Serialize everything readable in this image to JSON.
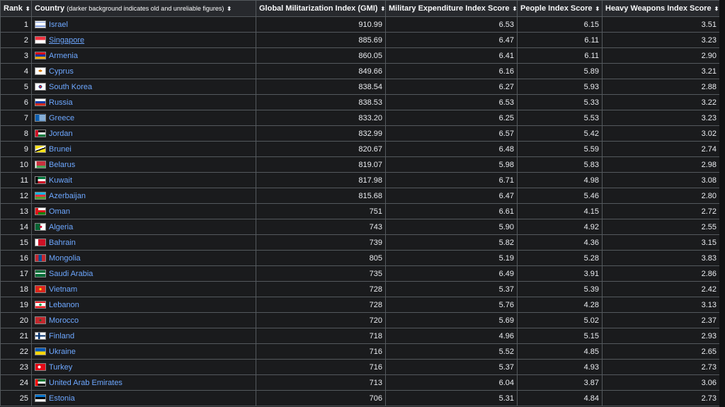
{
  "headers": {
    "rank": "Rank",
    "country": "Country",
    "country_note": "(darker background indicates old and unreliable figures)",
    "gmi": "Global Militarization Index (GMI)",
    "mil": "Military Expenditure Index Score",
    "people": "People Index Score",
    "heavy": "Heavy Weapons Index Score",
    "sort_icon": "⬍"
  },
  "rows": [
    {
      "rank": "1",
      "country": "Israel",
      "gmi": "910.99",
      "mil": "6.53",
      "people": "6.15",
      "heavy": "3.51",
      "flag": "israel-flag"
    },
    {
      "rank": "2",
      "country": "Singapore",
      "gmi": "885.69",
      "mil": "6.47",
      "people": "6.11",
      "heavy": "3.23",
      "flag": "singapore-flag"
    },
    {
      "rank": "3",
      "country": "Armenia",
      "gmi": "860.05",
      "mil": "6.41",
      "people": "6.11",
      "heavy": "2.90",
      "flag": "armenia-flag"
    },
    {
      "rank": "4",
      "country": "Cyprus",
      "gmi": "849.66",
      "mil": "6.16",
      "people": "5.89",
      "heavy": "3.21",
      "flag": "cyprus-flag"
    },
    {
      "rank": "5",
      "country": "South Korea",
      "gmi": "838.54",
      "mil": "6.27",
      "people": "5.93",
      "heavy": "2.88",
      "flag": "south-korea-flag"
    },
    {
      "rank": "6",
      "country": "Russia",
      "gmi": "838.53",
      "mil": "6.53",
      "people": "5.33",
      "heavy": "3.22",
      "flag": "russia-flag"
    },
    {
      "rank": "7",
      "country": "Greece",
      "gmi": "833.20",
      "mil": "6.25",
      "people": "5.53",
      "heavy": "3.23",
      "flag": "greece-flag"
    },
    {
      "rank": "8",
      "country": "Jordan",
      "gmi": "832.99",
      "mil": "6.57",
      "people": "5.42",
      "heavy": "3.02",
      "flag": "jordan-flag"
    },
    {
      "rank": "9",
      "country": "Brunei",
      "gmi": "820.67",
      "mil": "6.48",
      "people": "5.59",
      "heavy": "2.74",
      "flag": "brunei-flag"
    },
    {
      "rank": "10",
      "country": "Belarus",
      "gmi": "819.07",
      "mil": "5.98",
      "people": "5.83",
      "heavy": "2.98",
      "flag": "belarus-flag"
    },
    {
      "rank": "11",
      "country": "Kuwait",
      "gmi": "817.98",
      "mil": "6.71",
      "people": "4.98",
      "heavy": "3.08",
      "flag": "kuwait-flag"
    },
    {
      "rank": "12",
      "country": "Azerbaijan",
      "gmi": "815.68",
      "mil": "6.47",
      "people": "5.46",
      "heavy": "2.80",
      "flag": "azerbaijan-flag"
    },
    {
      "rank": "13",
      "country": "Oman",
      "gmi": "751",
      "mil": "6.61",
      "people": "4.15",
      "heavy": "2.72",
      "flag": "oman-flag"
    },
    {
      "rank": "14",
      "country": "Algeria",
      "gmi": "743",
      "mil": "5.90",
      "people": "4.92",
      "heavy": "2.55",
      "flag": "algeria-flag"
    },
    {
      "rank": "15",
      "country": "Bahrain",
      "gmi": "739",
      "mil": "5.82",
      "people": "4.36",
      "heavy": "3.15",
      "flag": "bahrain-flag"
    },
    {
      "rank": "16",
      "country": "Mongolia",
      "gmi": "805",
      "mil": "5.19",
      "people": "5.28",
      "heavy": "3.83",
      "flag": "mongolia-flag"
    },
    {
      "rank": "17",
      "country": "Saudi Arabia",
      "gmi": "735",
      "mil": "6.49",
      "people": "3.91",
      "heavy": "2.86",
      "flag": "saudi-arabia-flag"
    },
    {
      "rank": "18",
      "country": "Vietnam",
      "gmi": "728",
      "mil": "5.37",
      "people": "5.39",
      "heavy": "2.42",
      "flag": "vietnam-flag"
    },
    {
      "rank": "19",
      "country": "Lebanon",
      "gmi": "728",
      "mil": "5.76",
      "people": "4.28",
      "heavy": "3.13",
      "flag": "lebanon-flag"
    },
    {
      "rank": "20",
      "country": "Morocco",
      "gmi": "720",
      "mil": "5.69",
      "people": "5.02",
      "heavy": "2.37",
      "flag": "morocco-flag"
    },
    {
      "rank": "21",
      "country": "Finland",
      "gmi": "718",
      "mil": "4.96",
      "people": "5.15",
      "heavy": "2.93",
      "flag": "finland-flag"
    },
    {
      "rank": "22",
      "country": "Ukraine",
      "gmi": "716",
      "mil": "5.52",
      "people": "4.85",
      "heavy": "2.65",
      "flag": "ukraine-flag"
    },
    {
      "rank": "23",
      "country": "Turkey",
      "gmi": "716",
      "mil": "5.37",
      "people": "4.93",
      "heavy": "2.73",
      "flag": "turkey-flag"
    },
    {
      "rank": "24",
      "country": "United Arab Emirates",
      "gmi": "713",
      "mil": "6.04",
      "people": "3.87",
      "heavy": "3.06",
      "flag": "uae-flag"
    },
    {
      "rank": "25",
      "country": "Estonia",
      "gmi": "706",
      "mil": "5.31",
      "people": "4.84",
      "heavy": "2.73",
      "flag": "estonia-flag"
    }
  ],
  "colors": {
    "link": "#6da7ff",
    "header_bg": "#27292d",
    "row_bg": "#1a1b1d",
    "border": "#54595d"
  }
}
